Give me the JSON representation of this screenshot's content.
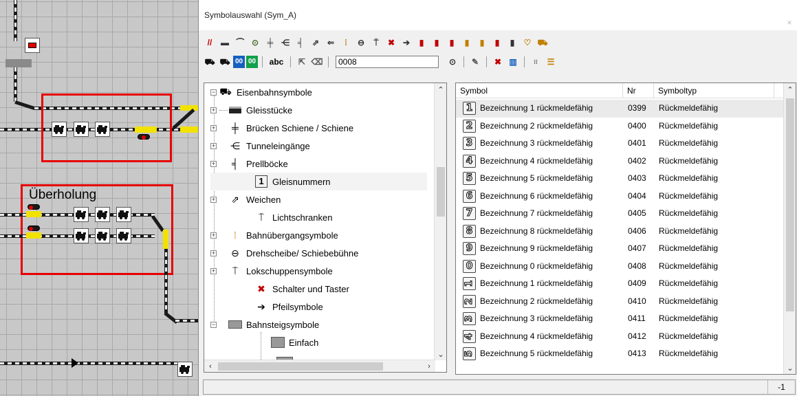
{
  "window": {
    "title": "Symbolauswahl (Sym_A)"
  },
  "trackplan": {
    "overholung_label": "Überholung"
  },
  "toolbar2": {
    "text_tool_label": "abc",
    "number_value": "0008",
    "zeros_label_a": "00",
    "zeros_label_b": "00"
  },
  "tree": {
    "items": [
      {
        "label": "Eisenbahnsymbole",
        "icon": "locomotive-icon",
        "expander": "−"
      },
      {
        "label": "Gleisstücke",
        "icon": "track-piece-icon",
        "expander": "+"
      },
      {
        "label": "Brücken Schiene / Schiene",
        "icon": "bridge-icon",
        "expander": "+"
      },
      {
        "label": "Tunneleingänge",
        "icon": "tunnel-icon",
        "expander": "+"
      },
      {
        "label": "Prellböcke",
        "icon": "buffer-stop-icon",
        "expander": "+"
      },
      {
        "label": "Gleisnummern",
        "icon": "track-number-icon",
        "expander": ""
      },
      {
        "label": "Weichen",
        "icon": "switch-icon",
        "expander": "+"
      },
      {
        "label": "Lichtschranken",
        "icon": "light-barrier-icon",
        "expander": ""
      },
      {
        "label": "Bahnübergangsymbole",
        "icon": "level-crossing-icon",
        "expander": "+"
      },
      {
        "label": "Drehscheibe/ Schiebebühne",
        "icon": "turntable-icon",
        "expander": "+"
      },
      {
        "label": "Lokschuppensymbole",
        "icon": "engine-shed-icon",
        "expander": "+"
      },
      {
        "label": "Schalter und Taster",
        "icon": "switch-button-icon",
        "expander": ""
      },
      {
        "label": "Pfeilsymbole",
        "icon": "arrow-icon",
        "expander": ""
      },
      {
        "label": "Bahnsteigsymbole",
        "icon": "platform-icon",
        "expander": "−"
      },
      {
        "label": "Einfach",
        "icon": "platform-simple-icon",
        "expander": ""
      }
    ]
  },
  "list": {
    "columns": [
      "Symbol",
      "Nr",
      "Symboltyp"
    ],
    "rows": [
      {
        "glyph": "1",
        "symbol": "Bezeichnung 1 rückmeldefähig",
        "nr": "0399",
        "typ": "Rückmeldefähig",
        "rotated": false
      },
      {
        "glyph": "2",
        "symbol": "Bezeichnung 2 rückmeldefähig",
        "nr": "0400",
        "typ": "Rückmeldefähig",
        "rotated": false
      },
      {
        "glyph": "3",
        "symbol": "Bezeichnung 3 rückmeldefähig",
        "nr": "0401",
        "typ": "Rückmeldefähig",
        "rotated": false
      },
      {
        "glyph": "4",
        "symbol": "Bezeichnung 4 rückmeldefähig",
        "nr": "0402",
        "typ": "Rückmeldefähig",
        "rotated": false
      },
      {
        "glyph": "5",
        "symbol": "Bezeichnung 5 rückmeldefähig",
        "nr": "0403",
        "typ": "Rückmeldefähig",
        "rotated": false
      },
      {
        "glyph": "6",
        "symbol": "Bezeichnung 6 rückmeldefähig",
        "nr": "0404",
        "typ": "Rückmeldefähig",
        "rotated": false
      },
      {
        "glyph": "7",
        "symbol": "Bezeichnung 7 rückmeldefähig",
        "nr": "0405",
        "typ": "Rückmeldefähig",
        "rotated": false
      },
      {
        "glyph": "8",
        "symbol": "Bezeichnung 8 rückmeldefähig",
        "nr": "0406",
        "typ": "Rückmeldefähig",
        "rotated": false
      },
      {
        "glyph": "9",
        "symbol": "Bezeichnung 9 rückmeldefähig",
        "nr": "0407",
        "typ": "Rückmeldefähig",
        "rotated": false
      },
      {
        "glyph": "0",
        "symbol": "Bezeichnung 0 rückmeldefähig",
        "nr": "0408",
        "typ": "Rückmeldefähig",
        "rotated": false
      },
      {
        "glyph": "1",
        "symbol": "Bezeichnung 1 rückmeldefähig",
        "nr": "0409",
        "typ": "Rückmeldefähig",
        "rotated": true
      },
      {
        "glyph": "2",
        "symbol": "Bezeichnung 2 rückmeldefähig",
        "nr": "0410",
        "typ": "Rückmeldefähig",
        "rotated": true
      },
      {
        "glyph": "3",
        "symbol": "Bezeichnung 3 rückmeldefähig",
        "nr": "0411",
        "typ": "Rückmeldefähig",
        "rotated": true
      },
      {
        "glyph": "4",
        "symbol": "Bezeichnung 4 rückmeldefähig",
        "nr": "0412",
        "typ": "Rückmeldefähig",
        "rotated": true
      },
      {
        "glyph": "5",
        "symbol": "Bezeichnung 5 rückmeldefähig",
        "nr": "0413",
        "typ": "Rückmeldefähig",
        "rotated": true
      }
    ]
  },
  "statusbar": {
    "right_value": "-1"
  },
  "colors": {
    "highlight_box": "#e60000",
    "track_yellow": "#f2e200",
    "signal_red": "#e00000"
  }
}
